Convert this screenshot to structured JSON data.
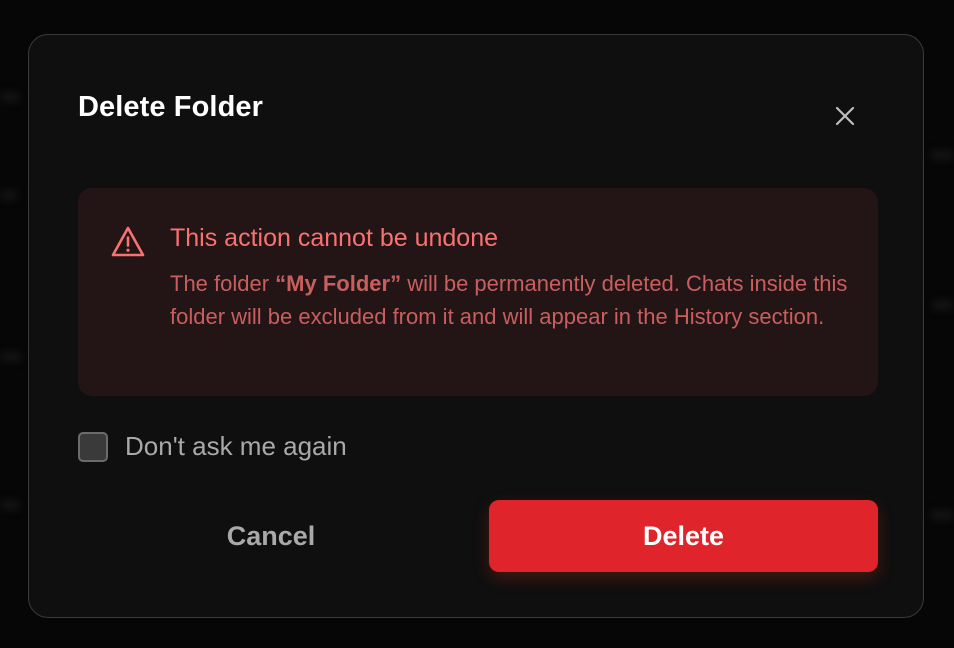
{
  "dialog": {
    "title": "Delete Folder",
    "close_icon": "close-icon"
  },
  "warning": {
    "icon": "warning-triangle-icon",
    "title": "This action cannot be undone",
    "body_prefix": "The folder ",
    "folder_name": "“My Folder”",
    "body_suffix": " will be permanently deleted. Chats inside this folder will be excluded from it and will appear in the History section."
  },
  "checkbox": {
    "label": "Don't ask me again",
    "checked": false
  },
  "buttons": {
    "cancel_label": "Cancel",
    "delete_label": "Delete"
  },
  "colors": {
    "accent_danger": "#e0242b",
    "warning_text": "#f87272",
    "warning_bg": "#231415",
    "dialog_bg": "#0f0f0f"
  }
}
